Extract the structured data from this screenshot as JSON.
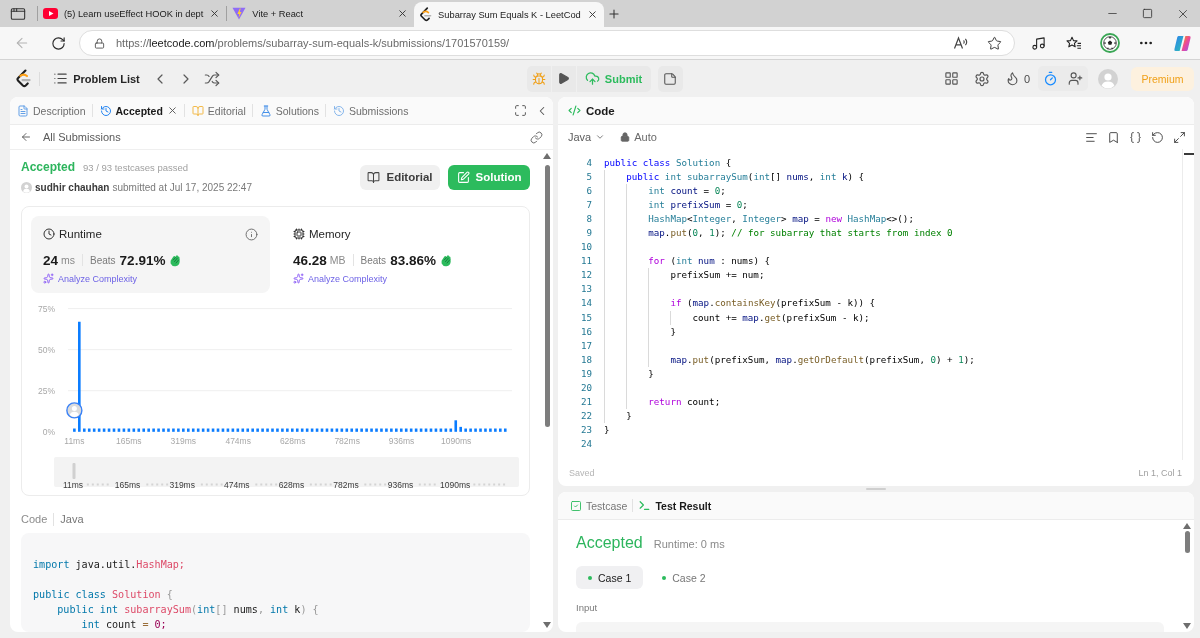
{
  "browser": {
    "tabs": [
      {
        "kind": "video",
        "title": "(5) Learn useEffect HOOK in dept",
        "selected": false
      },
      {
        "kind": "vite",
        "title": "Vite + React",
        "selected": false
      },
      {
        "kind": "leetcode",
        "title": "Subarray Sum Equals K - LeetCod",
        "selected": true
      }
    ],
    "url": {
      "scheme": "https://",
      "host": "leetcode.com",
      "path": "/problems/subarray-sum-equals-k/submissions/1701570159/"
    }
  },
  "toolbar": {
    "problem_list": "Problem List",
    "submit": "Submit",
    "streak": "0",
    "premium": "Premium"
  },
  "left_panel": {
    "tabs": [
      {
        "kind": "description",
        "label": "Description",
        "selected": false,
        "closable": false
      },
      {
        "kind": "accepted",
        "label": "Accepted",
        "selected": true,
        "closable": true
      },
      {
        "kind": "editorial",
        "label": "Editorial",
        "selected": false,
        "closable": false
      },
      {
        "kind": "solutions",
        "label": "Solutions",
        "selected": false,
        "closable": false
      },
      {
        "kind": "submissions",
        "label": "Submissions",
        "selected": false,
        "closable": false
      }
    ],
    "back_link": "All Submissions",
    "result": {
      "status": "Accepted",
      "testcases": "93 / 93 testcases passed",
      "author": "sudhir chauhan",
      "submitted": "submitted at Jul 17, 2025 22:47"
    },
    "actions": [
      {
        "kind": "secondary",
        "label": "Editorial"
      },
      {
        "kind": "primary",
        "label": "Solution"
      }
    ],
    "stats": [
      {
        "kind": "runtime",
        "title": "Runtime",
        "value": "24",
        "unit": "ms",
        "beats_label": "Beats",
        "beats": "72.91%",
        "analyze": "Analyze Complexity",
        "selected": true
      },
      {
        "kind": "memory",
        "title": "Memory",
        "value": "46.28",
        "unit": "MB",
        "beats_label": "Beats",
        "beats": "83.86%",
        "analyze": "Analyze Complexity",
        "selected": false
      }
    ],
    "chart_data": {
      "type": "bar",
      "x": [
        11,
        25,
        39,
        53,
        67,
        81,
        95,
        109,
        123,
        137,
        151,
        165,
        179,
        193,
        207,
        221,
        235,
        249,
        263,
        277,
        291,
        305,
        319,
        333,
        347,
        361,
        375,
        389,
        403,
        417,
        431,
        445,
        459,
        473,
        487,
        501,
        515,
        529,
        543,
        557,
        571,
        585,
        599,
        613,
        627,
        641,
        655,
        669,
        683,
        697,
        711,
        725,
        739,
        753,
        767,
        781,
        795,
        809,
        823,
        837,
        851,
        865,
        879,
        893,
        907,
        921,
        935,
        949,
        963,
        977,
        991,
        1005,
        1019,
        1033,
        1047,
        1061,
        1075,
        1089,
        1103,
        1117,
        1131,
        1145,
        1159,
        1173,
        1187,
        1201,
        1215,
        1229
      ],
      "values": [
        2,
        67,
        2,
        2,
        2,
        2,
        2,
        2,
        2,
        2,
        2,
        2,
        2,
        2,
        2,
        2,
        2,
        2,
        2,
        2,
        2,
        2,
        2,
        2,
        2,
        2,
        2,
        2,
        2,
        2,
        2,
        2,
        2,
        2,
        2,
        2,
        2,
        2,
        2,
        2,
        2,
        2,
        2,
        2,
        2,
        2,
        2,
        2,
        2,
        2,
        2,
        2,
        2,
        2,
        2,
        2,
        2,
        2,
        2,
        2,
        2,
        2,
        2,
        2,
        2,
        2,
        2,
        2,
        2,
        2,
        2,
        2,
        2,
        2,
        2,
        2,
        2,
        7,
        3,
        2,
        2,
        2,
        2,
        2,
        2,
        2,
        2,
        2
      ],
      "xlim": [
        -7,
        1248
      ],
      "ylim": [
        0,
        75
      ],
      "yticks": [
        {
          "value": 0,
          "label": "0%"
        },
        {
          "value": 25,
          "label": "25%"
        },
        {
          "value": 50,
          "label": "50%"
        },
        {
          "value": 75,
          "label": "75%"
        }
      ],
      "xticks": [
        {
          "value": 11,
          "label": "11ms"
        },
        {
          "value": 165,
          "label": "165ms"
        },
        {
          "value": 319,
          "label": "319ms"
        },
        {
          "value": 474,
          "label": "474ms"
        },
        {
          "value": 628,
          "label": "628ms"
        },
        {
          "value": 782,
          "label": "782ms"
        },
        {
          "value": 936,
          "label": "936ms"
        },
        {
          "value": 1090,
          "label": "1090ms"
        }
      ]
    },
    "navigator": {
      "labels": [
        "11ms",
        "165ms",
        "319ms",
        "474ms",
        "628ms",
        "782ms",
        "936ms",
        "1090ms"
      ]
    },
    "code": {
      "label": "Code",
      "language": "Java",
      "lines": [
        {
          "kind": "code",
          "tokens": [
            {
              "kind": "keyword",
              "text": "import"
            },
            {
              "kind": "plain",
              "text": " java.util."
            },
            {
              "kind": "class-name",
              "text": "HashMap;"
            }
          ]
        },
        {
          "kind": "blank"
        },
        {
          "kind": "code",
          "tokens": [
            {
              "kind": "keyword",
              "text": "public class "
            },
            {
              "kind": "class-name",
              "text": "Solution"
            },
            {
              "kind": "punctuation",
              "text": " {"
            }
          ]
        },
        {
          "kind": "code",
          "tokens": [
            {
              "kind": "keyword",
              "text": "    public int "
            },
            {
              "kind": "class-name",
              "text": "subarraySum"
            },
            {
              "kind": "punctuation",
              "text": "("
            },
            {
              "kind": "keyword",
              "text": "int"
            },
            {
              "kind": "punctuation",
              "text": "[]"
            },
            {
              "kind": "plain",
              "text": " nums"
            },
            {
              "kind": "punctuation",
              "text": ","
            },
            {
              "kind": "keyword",
              "text": " int"
            },
            {
              "kind": "plain",
              "text": " k"
            },
            {
              "kind": "punctuation",
              "text": ") {"
            }
          ]
        },
        {
          "kind": "code",
          "tokens": [
            {
              "kind": "keyword",
              "text": "        int"
            },
            {
              "kind": "plain",
              "text": " count "
            },
            {
              "kind": "operator",
              "text": "="
            },
            {
              "kind": "number",
              "text": " 0;"
            }
          ]
        }
      ]
    }
  },
  "code_panel": {
    "title": "Code",
    "language": "Java",
    "mode": "Auto",
    "lines": [
      {
        "number": "4",
        "tokens": [
          {
            "kind": "keyword",
            "text": "public class "
          },
          {
            "kind": "type",
            "text": "Solution"
          },
          {
            "kind": "plain",
            "text": " {"
          }
        ]
      },
      {
        "number": "5",
        "tokens": [
          {
            "kind": "keyword",
            "text": "    public "
          },
          {
            "kind": "type",
            "text": "int subarraySum"
          },
          {
            "kind": "plain",
            "text": "("
          },
          {
            "kind": "type",
            "text": "int"
          },
          {
            "kind": "plain",
            "text": "[] "
          },
          {
            "kind": "variable",
            "text": "nums"
          },
          {
            "kind": "plain",
            "text": ", "
          },
          {
            "kind": "type",
            "text": "int "
          },
          {
            "kind": "variable",
            "text": "k"
          },
          {
            "kind": "plain",
            "text": ") {"
          }
        ]
      },
      {
        "number": "6",
        "tokens": [
          {
            "kind": "type",
            "text": "        int "
          },
          {
            "kind": "variable",
            "text": "count"
          },
          {
            "kind": "plain",
            "text": " = "
          },
          {
            "kind": "number",
            "text": "0"
          },
          {
            "kind": "plain",
            "text": ";"
          }
        ]
      },
      {
        "number": "7",
        "tokens": [
          {
            "kind": "type",
            "text": "        int "
          },
          {
            "kind": "variable",
            "text": "prefixSum"
          },
          {
            "kind": "plain",
            "text": " = "
          },
          {
            "kind": "number",
            "text": "0"
          },
          {
            "kind": "plain",
            "text": ";"
          }
        ]
      },
      {
        "number": "8",
        "tokens": [
          {
            "kind": "type",
            "text": "        HashMap"
          },
          {
            "kind": "plain",
            "text": "<"
          },
          {
            "kind": "type",
            "text": "Integer"
          },
          {
            "kind": "plain",
            "text": ", "
          },
          {
            "kind": "type",
            "text": "Integer"
          },
          {
            "kind": "plain",
            "text": "> "
          },
          {
            "kind": "variable",
            "text": "map"
          },
          {
            "kind": "plain",
            "text": " = "
          },
          {
            "kind": "control",
            "text": "new "
          },
          {
            "kind": "type",
            "text": "HashMap"
          },
          {
            "kind": "plain",
            "text": "<>();"
          }
        ]
      },
      {
        "number": "9",
        "tokens": [
          {
            "kind": "variable",
            "text": "        map"
          },
          {
            "kind": "plain",
            "text": "."
          },
          {
            "kind": "method",
            "text": "put"
          },
          {
            "kind": "plain",
            "text": "("
          },
          {
            "kind": "number",
            "text": "0"
          },
          {
            "kind": "plain",
            "text": ", "
          },
          {
            "kind": "number",
            "text": "1"
          },
          {
            "kind": "plain",
            "text": "); "
          },
          {
            "kind": "comment",
            "text": "// for subarray that starts from index 0"
          }
        ]
      },
      {
        "number": "10"
      },
      {
        "number": "11",
        "tokens": [
          {
            "kind": "control",
            "text": "        for "
          },
          {
            "kind": "plain",
            "text": "("
          },
          {
            "kind": "type",
            "text": "int "
          },
          {
            "kind": "variable",
            "text": "num"
          },
          {
            "kind": "plain",
            "text": " : nums) {"
          }
        ]
      },
      {
        "number": "12",
        "tokens": [
          {
            "kind": "plain",
            "text": "            prefixSum += num;"
          }
        ]
      },
      {
        "number": "13"
      },
      {
        "number": "14",
        "tokens": [
          {
            "kind": "control",
            "text": "            if "
          },
          {
            "kind": "plain",
            "text": "("
          },
          {
            "kind": "variable",
            "text": "map"
          },
          {
            "kind": "plain",
            "text": "."
          },
          {
            "kind": "method",
            "text": "containsKey"
          },
          {
            "kind": "plain",
            "text": "(prefixSum - k)) {"
          }
        ]
      },
      {
        "number": "15",
        "tokens": [
          {
            "kind": "plain",
            "text": "                count += "
          },
          {
            "kind": "variable",
            "text": "map"
          },
          {
            "kind": "plain",
            "text": "."
          },
          {
            "kind": "method",
            "text": "get"
          },
          {
            "kind": "plain",
            "text": "(prefixSum - k);"
          }
        ]
      },
      {
        "number": "16",
        "tokens": [
          {
            "kind": "plain",
            "text": "            }"
          }
        ]
      },
      {
        "number": "17"
      },
      {
        "number": "18",
        "tokens": [
          {
            "kind": "variable",
            "text": "            map"
          },
          {
            "kind": "plain",
            "text": "."
          },
          {
            "kind": "method",
            "text": "put"
          },
          {
            "kind": "plain",
            "text": "(prefixSum, "
          },
          {
            "kind": "variable",
            "text": "map"
          },
          {
            "kind": "plain",
            "text": "."
          },
          {
            "kind": "method",
            "text": "getOrDefault"
          },
          {
            "kind": "plain",
            "text": "(prefixSum, "
          },
          {
            "kind": "number",
            "text": "0"
          },
          {
            "kind": "plain",
            "text": ") + "
          },
          {
            "kind": "number",
            "text": "1"
          },
          {
            "kind": "plain",
            "text": ");"
          }
        ]
      },
      {
        "number": "19",
        "tokens": [
          {
            "kind": "plain",
            "text": "        }"
          }
        ]
      },
      {
        "number": "20"
      },
      {
        "number": "21",
        "tokens": [
          {
            "kind": "control",
            "text": "        return "
          },
          {
            "kind": "plain",
            "text": "count;"
          }
        ]
      },
      {
        "number": "22",
        "tokens": [
          {
            "kind": "plain",
            "text": "    }"
          }
        ]
      },
      {
        "number": "23",
        "tokens": [
          {
            "kind": "plain",
            "text": "}"
          }
        ]
      },
      {
        "number": "24"
      }
    ],
    "status": "Saved",
    "cursor": "Ln 1, Col 1"
  },
  "test_panel": {
    "tabs": [
      {
        "kind": "testcase",
        "label": "Testcase",
        "selected": false
      },
      {
        "kind": "result",
        "label": "Test Result",
        "selected": true
      }
    ],
    "status": "Accepted",
    "runtime": "Runtime: 0 ms",
    "cases": [
      {
        "label": "Case 1",
        "selected": true
      },
      {
        "label": "Case 2",
        "selected": false
      }
    ],
    "input_label": "Input"
  }
}
